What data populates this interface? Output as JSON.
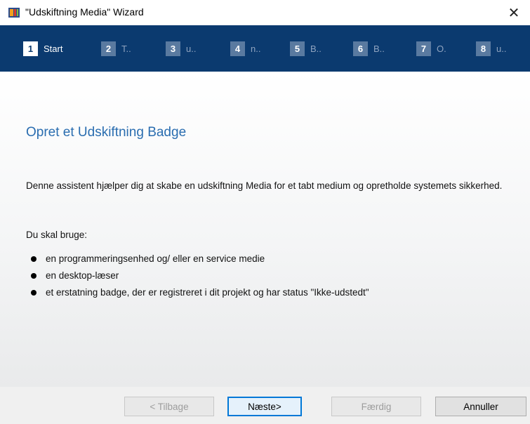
{
  "window": {
    "title": "\"Udskiftning Media\" Wizard",
    "close_symbol": "✕"
  },
  "steps": [
    {
      "number": "1",
      "label": "Start",
      "active": true
    },
    {
      "number": "2",
      "label": "T..",
      "active": false
    },
    {
      "number": "3",
      "label": "u..",
      "active": false
    },
    {
      "number": "4",
      "label": "n..",
      "active": false
    },
    {
      "number": "5",
      "label": "B..",
      "active": false
    },
    {
      "number": "6",
      "label": "B..",
      "active": false
    },
    {
      "number": "7",
      "label": "O.",
      "active": false
    },
    {
      "number": "8",
      "label": "u..",
      "active": false
    }
  ],
  "content": {
    "heading": "Opret et Udskiftning Badge",
    "description": "Denne assistent hjælper dig at skabe en udskiftning Media for et tabt medium og opretholde systemets sikkerhed.",
    "need_label": "Du skal bruge:",
    "items": [
      "en programmeringsenhed og/ eller en service medie",
      "en desktop-læser",
      "et erstatning badge, der er registreret i dit projekt og har status \"Ikke-udstedt\""
    ]
  },
  "buttons": {
    "back": "< Tilbage",
    "next": "Næste>",
    "finish": "Færdig",
    "cancel": "Annuller"
  },
  "colors": {
    "steps_bar": "#0b3a6f",
    "heading": "#2a6db0",
    "primary_border": "#0078d7"
  }
}
